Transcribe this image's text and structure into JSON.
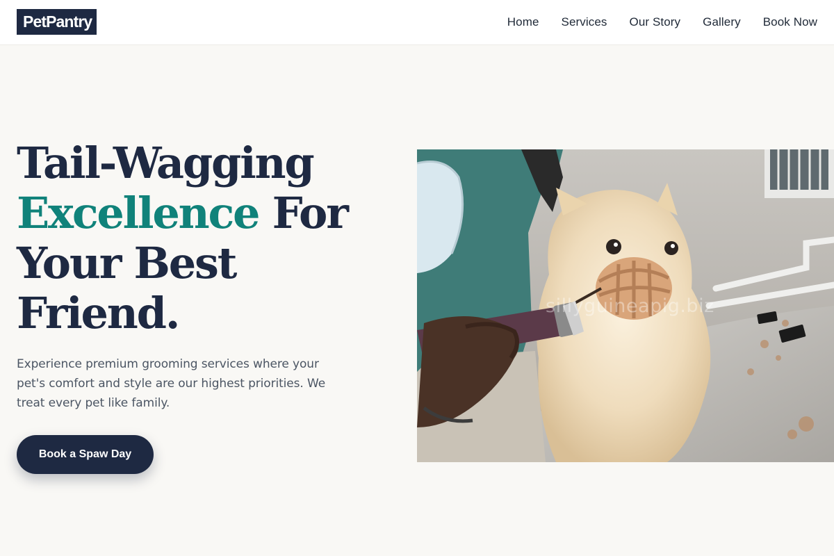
{
  "header": {
    "logo": "PetPantry",
    "nav": [
      "Home",
      "Services",
      "Our Story",
      "Gallery",
      "Book Now"
    ]
  },
  "hero": {
    "title_line1": "Tail-Wagging",
    "title_accent": "Excellence",
    "title_rest": " For Your Best Friend.",
    "description": "Experience premium grooming services where your pet's comfort and style are our highest priorities. We treat every pet like family.",
    "cta_label": "Book a Spaw Day",
    "image_watermark": "sillyguineapig.biz"
  },
  "colors": {
    "brand_navy": "#1e2942",
    "accent_teal": "#10827a",
    "page_background": "#f9f8f5"
  },
  "icons": [
    "groomer-photo",
    "dog-muzzle",
    "hair-clipper"
  ]
}
